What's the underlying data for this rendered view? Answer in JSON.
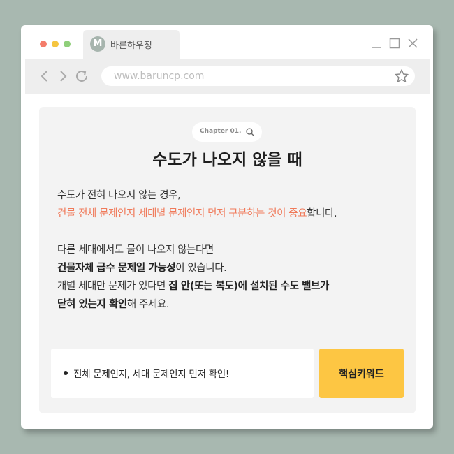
{
  "browser": {
    "tab": {
      "icon_letter": "M",
      "title": "바른하우징"
    },
    "address": {
      "url": "www.baruncp.com"
    }
  },
  "colors": {
    "background": "#a8b8b0",
    "highlight": "#f07a5a",
    "keyword_tag": "#fdc643"
  },
  "icons": {
    "window_controls": [
      "red-dot-icon",
      "yellow-dot-icon",
      "green-dot-icon"
    ],
    "toolbar": [
      "back-arrow-icon",
      "forward-arrow-icon",
      "reload-icon",
      "star-icon"
    ],
    "pill": "search-icon"
  },
  "content": {
    "chapter": "Chapter 01.",
    "title": "수도가 나오지 않을 때",
    "para1": {
      "line1": "수도가 전혀 나오지 않는 경우,",
      "line2_highlight": "건물 전체 문제인지 세대별 문제인지 먼저 구분하는 것이 중요",
      "line2_rest": "합니다."
    },
    "para2": {
      "line1": "다른 세대에서도 물이 나오지 않는다면",
      "line2_bold": "건물자체 급수 문제일 가능성",
      "line2_rest": "이 있습니다.",
      "line3_pre": "개별 세대만 문제가 있다면 ",
      "line3_bold": "집 안(또는 복도)에 설치된 수도 밸브가",
      "line4_bold": "닫혀 있는지 확인",
      "line4_rest": "해 주세요."
    },
    "keyword": {
      "text": "전체 문제인지, 세대 문제인지 먼저 확인!",
      "tag": "핵심키워드"
    }
  }
}
